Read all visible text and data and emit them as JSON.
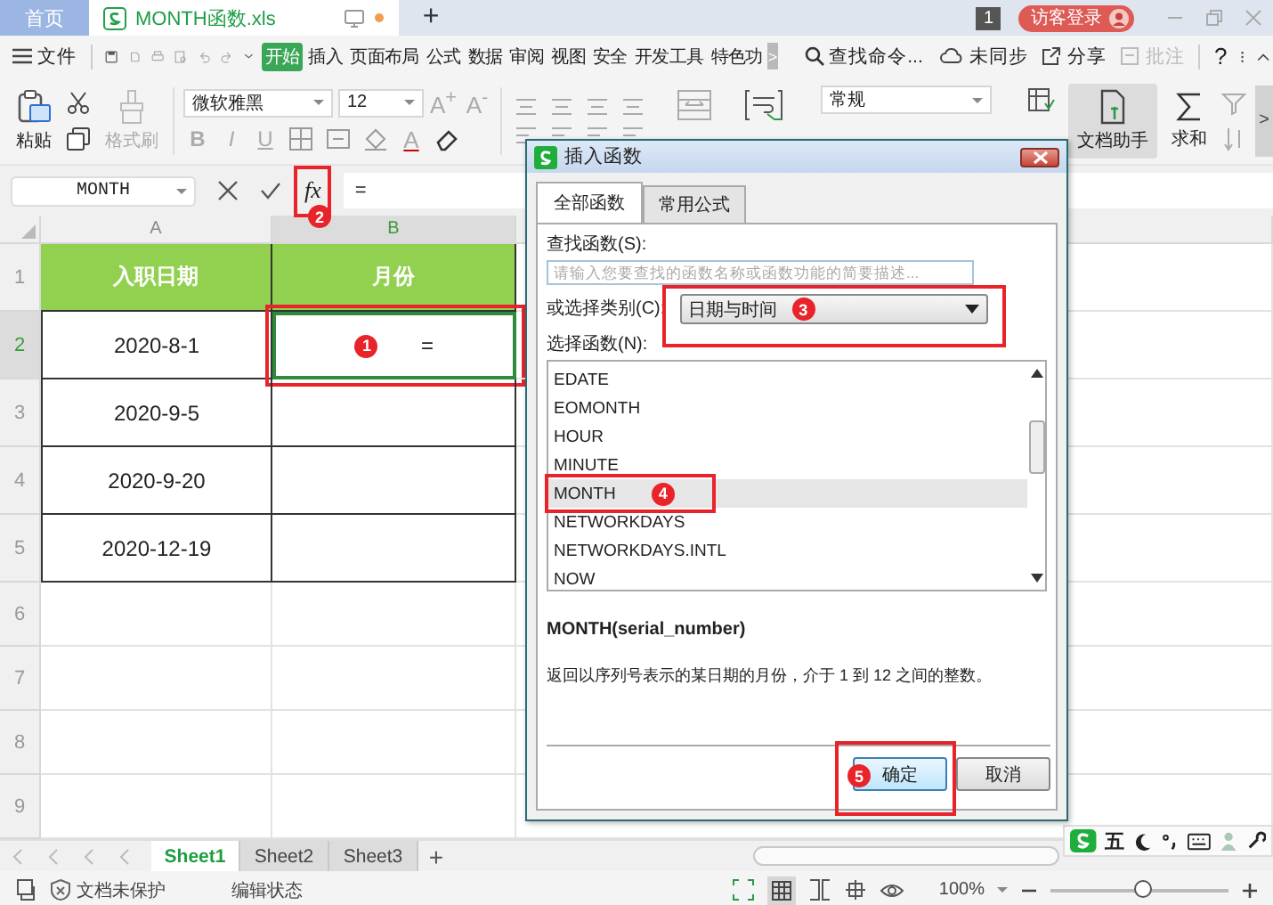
{
  "tabs": [
    {
      "label": "首页",
      "kind": "home",
      "selected": false
    },
    {
      "label": "MONTH函数.xls",
      "kind": "doc",
      "selected": true
    }
  ],
  "new_tab": "+",
  "title_right": {
    "badge": "1",
    "login": "访客登录"
  },
  "menu": {
    "file": "文件",
    "items": [
      {
        "label": "开始",
        "selected": true
      },
      {
        "label": "插入",
        "selected": false
      },
      {
        "label": "页面布局",
        "selected": false
      },
      {
        "label": "公式",
        "selected": false
      },
      {
        "label": "数据",
        "selected": false
      },
      {
        "label": "审阅",
        "selected": false
      },
      {
        "label": "视图",
        "selected": false
      },
      {
        "label": "安全",
        "selected": false
      },
      {
        "label": "开发工具",
        "selected": false
      },
      {
        "label": "特色功",
        "selected": false
      }
    ],
    "more": ">",
    "search": "查找命令...",
    "sync": "未同步",
    "share": "分享",
    "comment": "批注",
    "help": "?"
  },
  "ribbon": {
    "paste": "粘贴",
    "format_painter": "格式刷",
    "font": "微软雅黑",
    "size": "12",
    "grow": "A$^{+}$",
    "shrink": "A$^{-}$",
    "styles": [
      "B",
      "I",
      "U"
    ],
    "font_color": "A",
    "number_format": "常规",
    "assistant": "文档助手",
    "sum": "求和",
    "scroll": ">"
  },
  "formula_bar": {
    "name_box": "MONTH",
    "value": "=",
    "fx": "fx",
    "marker": "2"
  },
  "columns": [
    {
      "label": "A",
      "selected": false
    },
    {
      "label": "B",
      "selected": true
    }
  ],
  "rows": [
    {
      "header": "1",
      "kind": "heading",
      "selected": false,
      "a": "入职日期",
      "b": "月份"
    },
    {
      "header": "2",
      "kind": "data",
      "selected": true,
      "a": "2020-8-1",
      "b": "=",
      "marker": "1"
    },
    {
      "header": "3",
      "kind": "data",
      "selected": false,
      "a": "2020-9-5"
    },
    {
      "header": "4",
      "kind": "data",
      "selected": false,
      "a": "2020-9-20"
    },
    {
      "header": "5",
      "kind": "data",
      "selected": false,
      "a": "2020-12-19"
    },
    {
      "header": "6",
      "kind": "blank",
      "selected": false
    },
    {
      "header": "7",
      "kind": "blank",
      "selected": false
    },
    {
      "header": "8",
      "kind": "blank",
      "selected": false
    },
    {
      "header": "9",
      "kind": "blank",
      "selected": false
    }
  ],
  "sheets": [
    {
      "label": "Sheet1",
      "selected": true
    },
    {
      "label": "Sheet2",
      "selected": false
    },
    {
      "label": "Sheet3",
      "selected": false
    }
  ],
  "add_sheet": "+",
  "ime": {
    "mode": "五"
  },
  "status_bar": {
    "protection": "文档未保护",
    "mode": "编辑状态",
    "zoom": "100%",
    "zoom_slider": {
      "level": 0.52
    }
  },
  "dialog": {
    "title": "插入函数",
    "tabs": [
      {
        "label": "全部函数",
        "selected": true
      },
      {
        "label": "常用公式",
        "selected": false
      }
    ],
    "search": {
      "label": "查找函数(S):",
      "placeholder": "请输入您要查找的函数名称或函数功能的简要描述..."
    },
    "category": {
      "label": "或选择类别(C):",
      "value": "日期与时间",
      "marker": "3"
    },
    "list_label": "选择函数(N):",
    "functions": [
      {
        "name": "EDATE",
        "selected": false
      },
      {
        "name": "EOMONTH",
        "selected": false
      },
      {
        "name": "HOUR",
        "selected": false
      },
      {
        "name": "MINUTE",
        "selected": false
      },
      {
        "name": "MONTH",
        "selected": true,
        "marker": "4"
      },
      {
        "name": "NETWORKDAYS",
        "selected": false
      },
      {
        "name": "NETWORKDAYS.INTL",
        "selected": false
      },
      {
        "name": "NOW",
        "selected": false
      }
    ],
    "signature": "MONTH(serial_number)",
    "description": "返回以序列号表示的某日期的月份，介于 1 到 12 之间的整数。",
    "buttons": [
      {
        "label": "确定",
        "kind": "primary",
        "marker": "5"
      },
      {
        "label": "取消",
        "kind": "normal"
      }
    ]
  }
}
